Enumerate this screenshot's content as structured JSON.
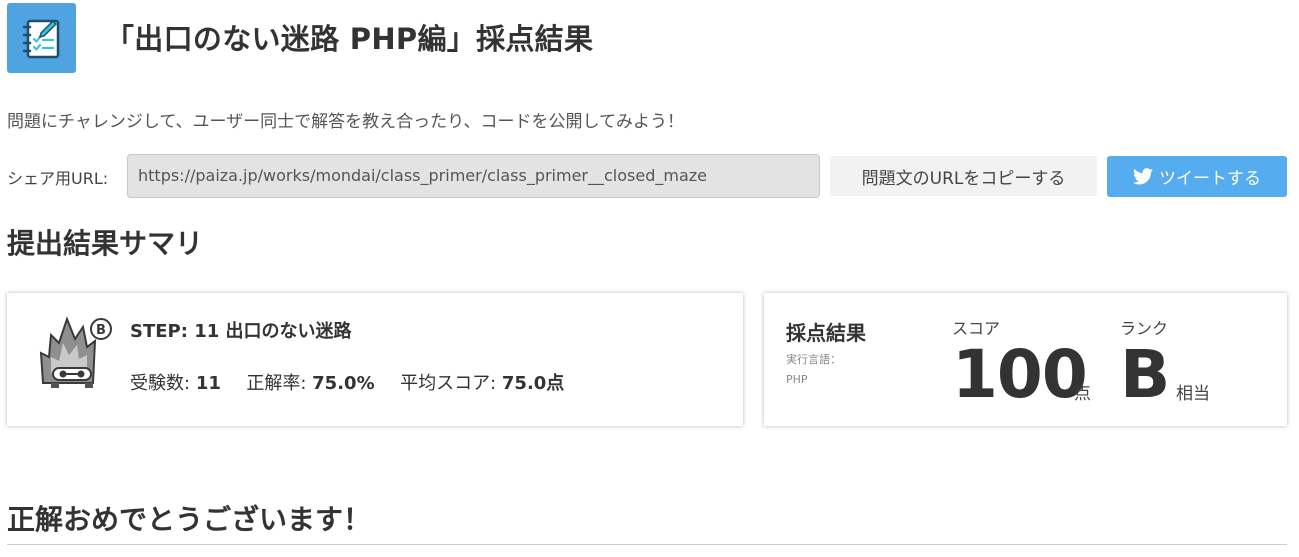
{
  "header": {
    "title": "「出口のない迷路 PHP編」採点結果",
    "logo_icon": "notebook-checklist-icon"
  },
  "intro_text": "問題にチャレンジして、ユーザー同士で解答を教え合ったり、コードを公開してみよう！",
  "share": {
    "label": "シェア用URL:",
    "url": "https://paiza.jp/works/mondai/class_primer/class_primer__closed_maze",
    "copy_button": "問題文のURLをコピーする",
    "tweet_button": "ツイートする",
    "tweet_color": "#55acee"
  },
  "summary": {
    "title": "提出結果サマリ",
    "step_title": "STEP: 11 出口のない迷路",
    "rank_badge": "B",
    "stats": {
      "examinees_label": "受験数:",
      "examinees_value": "11",
      "correct_rate_label": "正解率:",
      "correct_rate_value": "75.0%",
      "avg_score_label": "平均スコア:",
      "avg_score_value": "75.0点"
    }
  },
  "result": {
    "label": "採点結果",
    "lang_label": "実行言語：",
    "lang_value": "PHP",
    "score_label": "スコア",
    "score_value": "100",
    "score_unit": "点",
    "rank_label": "ランク",
    "rank_value": "B",
    "rank_unit": "相当"
  },
  "congrats": "正解おめでとうございます！",
  "colors": {
    "accent": "#4fa3e0",
    "text": "#333333"
  }
}
